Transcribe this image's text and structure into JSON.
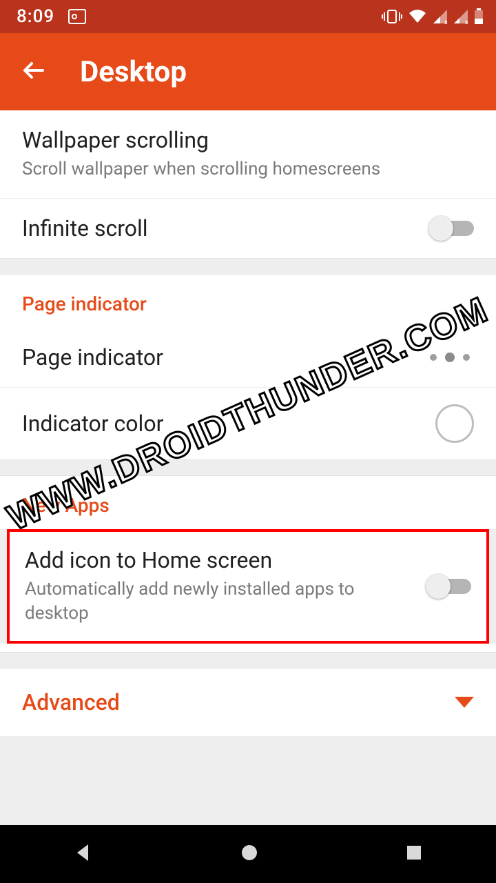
{
  "statusbar": {
    "time": "8:09"
  },
  "appbar": {
    "title": "Desktop"
  },
  "section1": {
    "wallpaper": {
      "title": "Wallpaper scrolling",
      "sub": "Scroll wallpaper when scrolling homescreens"
    },
    "infinite": {
      "title": "Infinite scroll"
    }
  },
  "section2": {
    "header": "Page indicator",
    "page_indicator": {
      "title": "Page indicator"
    },
    "indicator_color": {
      "title": "Indicator color"
    }
  },
  "section3": {
    "header": "New Apps",
    "add_icon": {
      "title": "Add icon to Home screen",
      "sub": "Automatically add newly installed apps to desktop"
    }
  },
  "advanced": {
    "label": "Advanced"
  },
  "watermark": "WWW.DROIDTHUNDER.COM",
  "colors": {
    "accent": "#e64a19",
    "status": "#b9331d",
    "highlight": "#ff0000"
  }
}
